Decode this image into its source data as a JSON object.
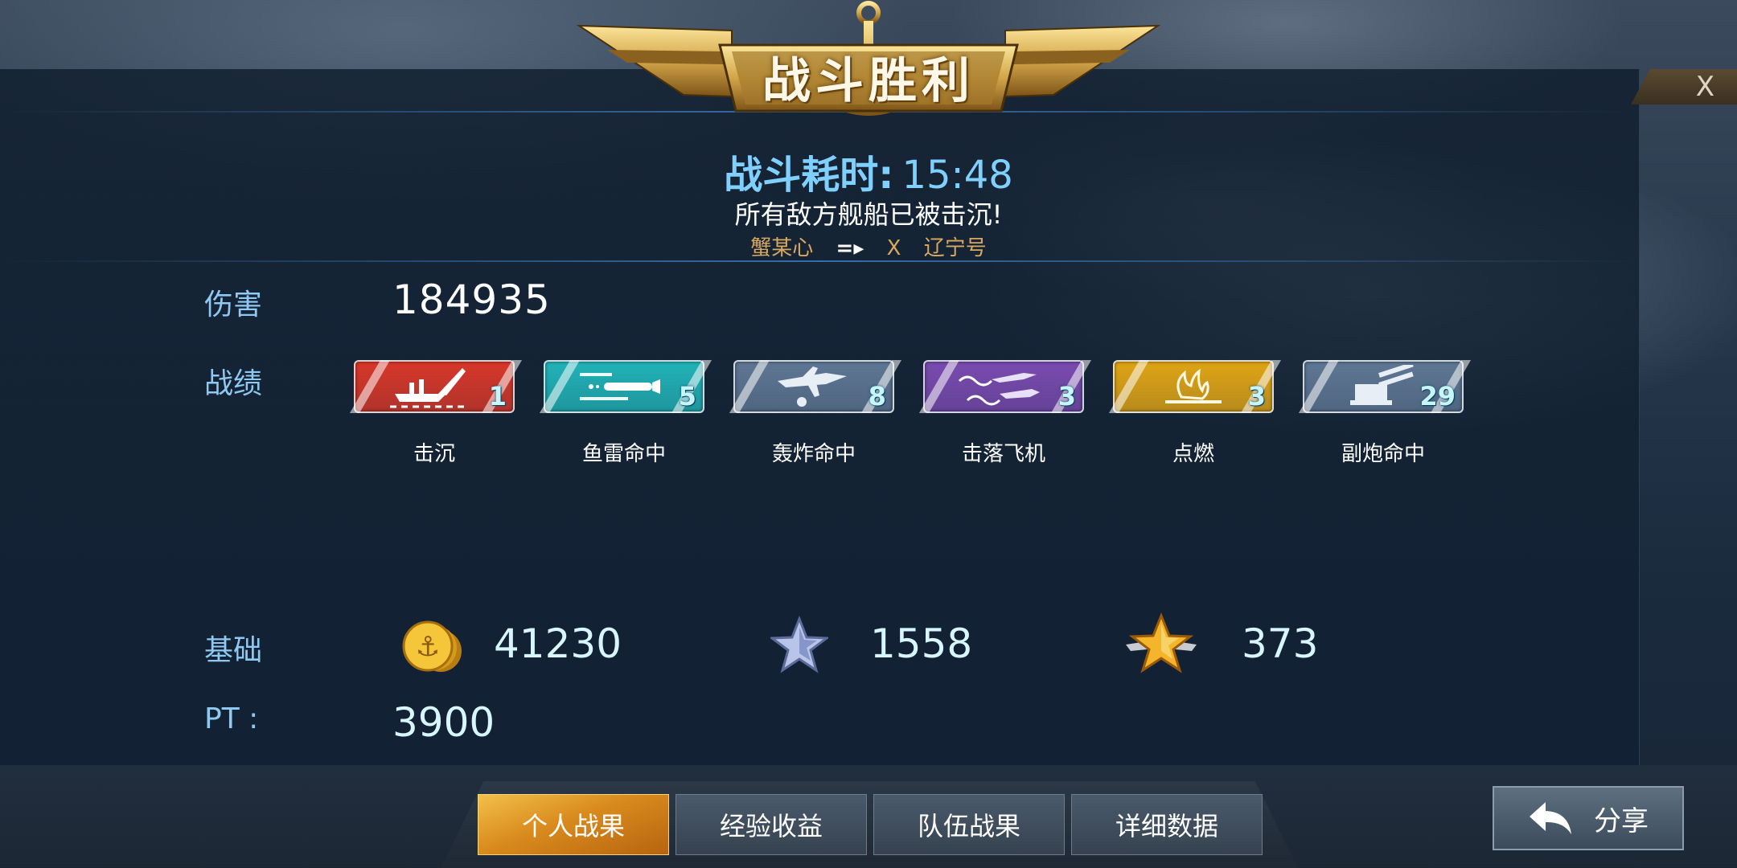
{
  "header": {
    "title": "战斗胜利",
    "close_label": "X",
    "duration_label": "战斗耗时:",
    "duration_value": "15:48",
    "result_text": "所有敌方舰船已被击沉!",
    "killer": "蟹某心",
    "kill_sep": "X",
    "victim": "辽宁号"
  },
  "stats": {
    "damage_label": "伤害",
    "damage_value": "184935",
    "record_label": "战绩",
    "base_label": "基础",
    "pt_label": "PT :",
    "pt_value": "3900"
  },
  "medals": [
    {
      "label": "击沉",
      "count": "1",
      "color": "#d8382a",
      "icon": "ship-sinking-icon"
    },
    {
      "label": "鱼雷命中",
      "count": "5",
      "color": "#22b3b8",
      "icon": "torpedo-icon"
    },
    {
      "label": "轰炸命中",
      "count": "8",
      "color": "#5f7794",
      "icon": "bomber-icon"
    },
    {
      "label": "击落飞机",
      "count": "3",
      "color": "#7a4bb0",
      "icon": "plane-shot-icon"
    },
    {
      "label": "点燃",
      "count": "3",
      "color": "#e0a516",
      "icon": "fire-icon"
    },
    {
      "label": "副炮命中",
      "count": "29",
      "color": "#5f7794",
      "icon": "turret-icon"
    }
  ],
  "rewards": {
    "coins": "41230",
    "silver_star": "1558",
    "gold_star": "373"
  },
  "tabs": [
    {
      "label": "个人战果",
      "active": true
    },
    {
      "label": "经验收益",
      "active": false
    },
    {
      "label": "队伍战果",
      "active": false
    },
    {
      "label": "详细数据",
      "active": false
    }
  ],
  "share_label": "分享"
}
